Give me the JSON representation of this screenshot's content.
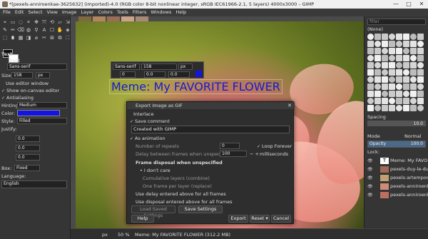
{
  "window": {
    "title": "*[pexels-anniroenkae-3625632] (imported)-4.0 (RGB color 8-bit nonlinear integer, sRGB IEC61966-2.1, 5 layers) 4000x3000 – GIMP",
    "minimize": "—",
    "maximize": "□",
    "close": "✕"
  },
  "menubar": [
    "File",
    "Edit",
    "Select",
    "View",
    "Image",
    "Layer",
    "Colors",
    "Tools",
    "Filters",
    "Windows",
    "Help"
  ],
  "toolbox": {
    "tools": [
      "⌖",
      "▭",
      "◌",
      "⌗",
      "✥",
      "⤧",
      "⟲",
      "▱",
      "⇲",
      "✎",
      "✏",
      "⌫",
      "◍",
      "⚲",
      "A",
      "☐",
      "✋",
      "◈",
      "⬚",
      "⬮",
      "▦",
      "◨",
      "⌀",
      "✂",
      "⊞",
      "⧉",
      "⛶"
    ],
    "section_title": "Text",
    "font_label": "Font",
    "font_value": "Sans-serif",
    "size_label": "Size:",
    "size_value": "158",
    "size_unit": "px",
    "use_editor": "Use editor window",
    "show_onscreen": "Show on-canvas editor",
    "antialiasing": "Antialiasing",
    "hinting_label": "Hinting:",
    "hinting_value": "Medium",
    "color_label": "Color:",
    "color_value": "#1414e0",
    "style_label": "Style:",
    "style_value": "Filled",
    "justify_label": "Justify:",
    "indent_values": [
      "0.0",
      "0.0",
      "0.0"
    ],
    "box_label": "Box:",
    "box_value": "Fixed",
    "language_label": "Language:",
    "language_value": "English"
  },
  "textbar": {
    "font": "Sans-serif",
    "size": "158",
    "unit": "px",
    "v1": "0",
    "v2": "0.0",
    "v3": "0.0"
  },
  "canvas": {
    "meme_text": "Meme: My FAVORITE FLOWER"
  },
  "dialog": {
    "title": "Export Image as GIF",
    "interlace": "Interlace",
    "save_comment": "Save comment",
    "comment_value": "Created with GIMP",
    "as_animation": "As animation",
    "repeats_label": "Number of repeats",
    "repeats_value": "0",
    "loop_forever": "Loop Forever",
    "delay_label": "Delay between frames when unspecified",
    "delay_value": "100",
    "delay_unit": "milliseconds",
    "disposal_label": "Frame disposal when unspecified",
    "dont_care": "I don't care",
    "cumulative": "Cumulative layers (combine)",
    "one_frame": "One frame per layer (replace)",
    "use_delay": "Use delay entered above for all frames",
    "use_disposal": "Use disposal entered above for all frames",
    "load_saved": "Load Saved Settings",
    "save_settings": "Save Settings",
    "help": "Help",
    "export": "Export",
    "reset": "Reset",
    "cancel": "Cancel"
  },
  "dock": {
    "filter_placeholder": "filter",
    "brush_none": "(None)",
    "spacing_label": "Spacing",
    "spacing_value": "10.0",
    "mode_label": "Mode",
    "mode_value": "Normal",
    "opacity_label": "Opacity",
    "opacity_value": "100.0",
    "lock_label": "Lock:",
    "layers": [
      "Meme: My FAVORI",
      "pexels-duy-le-du",
      "pexels-artempod",
      "pexels-anniroenl",
      "pexels-anniroenl"
    ]
  },
  "statusbar": {
    "unit": "px",
    "zoom": "50 %",
    "info": "Meme: My FAVORITE FLOWER (312.2 MB)"
  },
  "colors": {
    "accent": "#1414e0"
  }
}
